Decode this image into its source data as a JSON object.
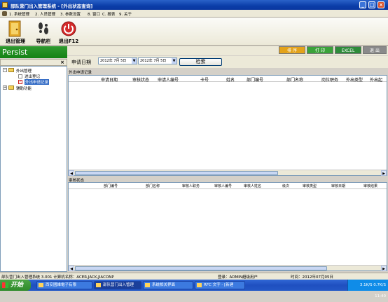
{
  "window": {
    "title": "部队营门出入管理系统 - [外出状态查询]",
    "min": "_",
    "max": "□",
    "close": "×"
  },
  "menu": [
    "1. 系统管理",
    "2. 人员管理",
    "3. 参数设置",
    "8. 窗口",
    "C. 报表",
    "9. 关于"
  ],
  "toolbar": {
    "exit_label": "退出管理",
    "nav_label": "导航栏",
    "quit_label": "退出F12"
  },
  "sidebar": {
    "brand": "Persist",
    "close_glyph": "×",
    "tree": {
      "group1": "外出管理",
      "item1": "进出登记",
      "item2": "外出申请记录",
      "group2": "辅助功能"
    }
  },
  "actions": {
    "sort": "排 序",
    "print": "打 印",
    "excel": "EXCEL",
    "exit": "退 出"
  },
  "search": {
    "label": "申请日期",
    "from": "2012年 7月 5日",
    "to": "2012年 7月 5日",
    "button": "检索"
  },
  "upper_grid": {
    "title": "外出申请记录",
    "columns": [
      "申请日期",
      "审核状态",
      "申请人编号",
      "卡号",
      "姓名",
      "部门编号",
      "部门名称",
      "岗位职务",
      "外出类型",
      "外出起"
    ]
  },
  "lower_grid": {
    "title": "审核状态",
    "columns": [
      "部门编号",
      "部门名称",
      "审核人职务",
      "审核人编号",
      "审核人姓名",
      "级次",
      "审核类型",
      "审核日期",
      "审核结果"
    ]
  },
  "statusbar": {
    "app": "部队营门出入管理系统 3.001 计算机名称：ACER,JACK,JIACONP",
    "login": "登录：ADMIN超级用户",
    "time": "时间：2012年07月05日"
  },
  "taskbar": {
    "start": "开始",
    "buttons": [
      "西安國維電子有限",
      "部队营门出入管理",
      "系统相关界面",
      "RFC 文字 - [新建"
    ],
    "tray": "3.1K/S 0.7K/S 11:40"
  },
  "colors": {
    "title_blue": "#0b3ea8",
    "persist_green": "#148214",
    "sort_orange": "#e3a21a",
    "print_green": "#3aa23a",
    "excel_green": "#2e8b3a",
    "exit_gray": "#8a8a8a"
  }
}
